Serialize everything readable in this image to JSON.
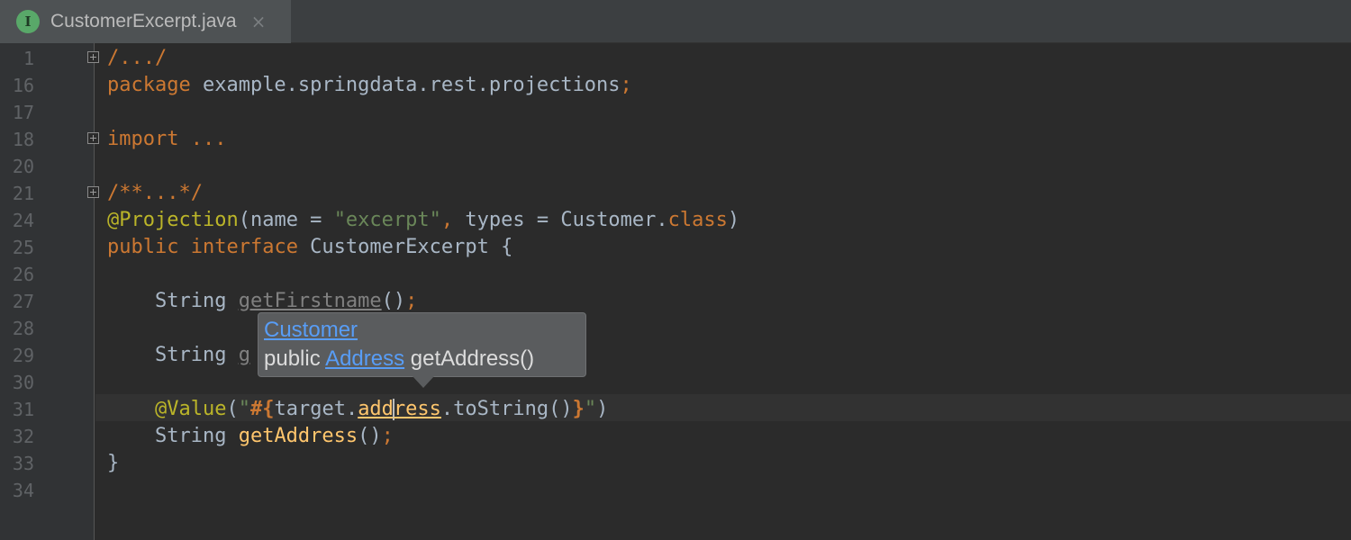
{
  "tab": {
    "icon_letter": "I",
    "title": "CustomerExcerpt.java",
    "close": "×"
  },
  "gutter": {
    "line_numbers": [
      "1",
      "16",
      "17",
      "18",
      "20",
      "21",
      "24",
      "25",
      "26",
      "27",
      "28",
      "29",
      "30",
      "31",
      "32",
      "33",
      "34"
    ]
  },
  "code": {
    "l1": {
      "fold": "/.../"
    },
    "l16": {
      "kw": "package",
      "pkg": " example.springdata.rest.projections",
      "semi": ";"
    },
    "l18": {
      "kw": "import",
      "rest": " ..."
    },
    "l21": {
      "fold": "/**...*/"
    },
    "l24": {
      "ann": "@Projection",
      "p1": "(",
      "name": "name",
      "eq1": " = ",
      "str": "\"excerpt\"",
      "comma": ", ",
      "types": "types",
      "eq2": " = ",
      "cls": "Customer.",
      "kwclass": "class",
      "p2": ")"
    },
    "l25": {
      "kw1": "public",
      "kw2": " interface",
      "name": " CustomerExcerpt {"
    },
    "l27": {
      "indent": "    ",
      "type": "String ",
      "method": "getFirstname",
      "paren": "()",
      "semi": ";"
    },
    "l29": {
      "indent": "    ",
      "type": "String ",
      "partial": "g"
    },
    "l31": {
      "indent": "    ",
      "ann": "@Value",
      "p1": "(",
      "q1": "\"",
      "brace1": "#{",
      "expr1": "target.",
      "hl1": "add",
      "hl2": "ress",
      "expr2": ".toString()",
      "brace2": "}",
      "q2": "\"",
      "p2": ")"
    },
    "l32": {
      "indent": "    ",
      "type": "String ",
      "method": "getAddress",
      "paren": "()",
      "semi": ";"
    },
    "l33": {
      "brace": "}"
    }
  },
  "popup": {
    "class_link": "Customer",
    "mod": "public ",
    "type_link": "Address",
    "sig": " getAddress()"
  },
  "colors": {
    "background": "#2b2b2b",
    "keyword": "#cc7832",
    "annotation": "#bbb529",
    "string": "#6a8759",
    "method": "#ffc66d",
    "link": "#589df6"
  }
}
